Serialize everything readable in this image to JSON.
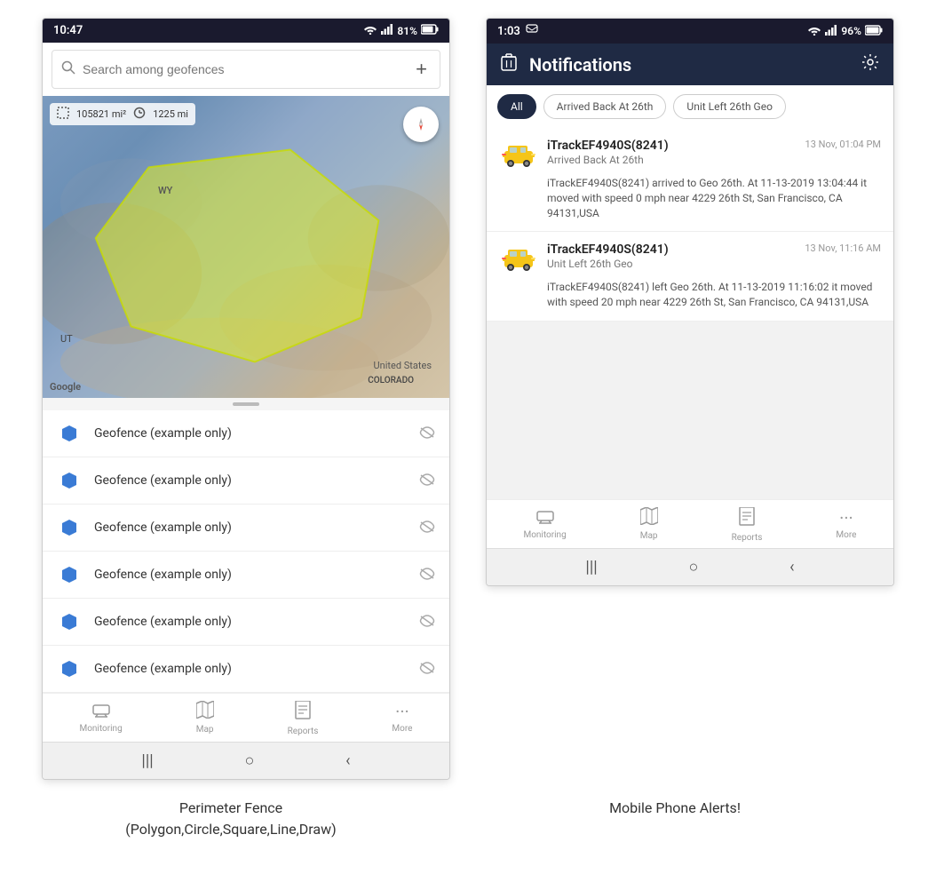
{
  "left_screen": {
    "status_bar": {
      "time": "10:47",
      "battery": "81%"
    },
    "search": {
      "placeholder": "Search among geofences"
    },
    "map": {
      "area": "105821 mi²",
      "distance": "1225 mi",
      "wy_label": "WY",
      "ut_label": "UT",
      "us_label": "United States",
      "colorado_label": "COLORADO",
      "google_label": "Google"
    },
    "geofence_items": [
      {
        "name": "Geofence (example only)"
      },
      {
        "name": "Geofence (example only)"
      },
      {
        "name": "Geofence (example only)"
      },
      {
        "name": "Geofence (example only)"
      },
      {
        "name": "Geofence (example only)"
      },
      {
        "name": "Geofence (example only)"
      }
    ],
    "nav": {
      "items": [
        "Monitoring",
        "Map",
        "Reports",
        "More"
      ]
    },
    "caption": "Perimeter Fence\n(Polygon,Circle,Square,Line,Draw)"
  },
  "right_screen": {
    "status_bar": {
      "time": "1:03",
      "battery": "96%"
    },
    "header": {
      "title": "Notifications",
      "delete_label": "delete",
      "settings_label": "settings"
    },
    "filters": [
      "All",
      "Arrived Back At 26th",
      "Unit Left 26th Geo"
    ],
    "notifications": [
      {
        "device": "iTrackEF4940S(8241)",
        "event": "Arrived Back At 26th",
        "time": "13 Nov, 01:04 PM",
        "body": "iTrackEF4940S(8241) arrived to Geo 26th.    At 11-13-2019 13:04:44 it moved with speed 0 mph near 4229 26th St, San Francisco, CA 94131,USA"
      },
      {
        "device": "iTrackEF4940S(8241)",
        "event": "Unit Left 26th Geo",
        "time": "13 Nov, 11:16 AM",
        "body": "iTrackEF4940S(8241) left Geo 26th.    At 11-13-2019 11:16:02 it moved with speed 20 mph near 4229 26th St, San Francisco, CA 94131,USA"
      }
    ],
    "nav": {
      "items": [
        "Monitoring",
        "Map",
        "Reports",
        "More"
      ]
    },
    "caption": "Mobile Phone Alerts!"
  },
  "colors": {
    "dark_header": "#1f2a44",
    "active_tab": "#1f2a44",
    "geofence_blue": "#3a7bd5",
    "polygon_yellow": "rgba(230,240,60,0.55)"
  }
}
